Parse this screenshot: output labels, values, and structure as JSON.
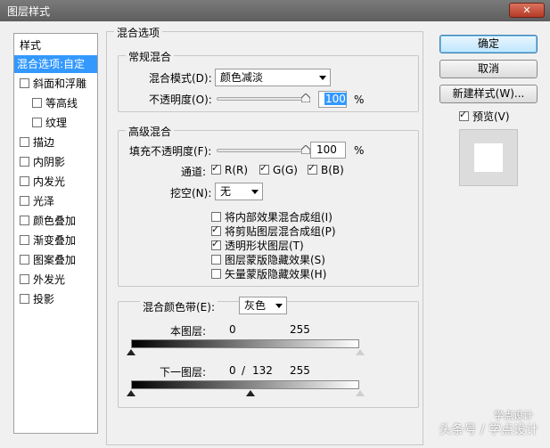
{
  "window": {
    "title": "图层样式",
    "close_label": "✕"
  },
  "stylelist": {
    "header": "样式",
    "items": [
      {
        "label": "混合选项:自定",
        "checkbox": false,
        "checked": false,
        "selected": true,
        "indent": false
      },
      {
        "label": "斜面和浮雕",
        "checkbox": true,
        "checked": false,
        "selected": false,
        "indent": false
      },
      {
        "label": "等高线",
        "checkbox": true,
        "checked": false,
        "selected": false,
        "indent": true
      },
      {
        "label": "纹理",
        "checkbox": true,
        "checked": false,
        "selected": false,
        "indent": true
      },
      {
        "label": "描边",
        "checkbox": true,
        "checked": false,
        "selected": false,
        "indent": false
      },
      {
        "label": "内阴影",
        "checkbox": true,
        "checked": false,
        "selected": false,
        "indent": false
      },
      {
        "label": "内发光",
        "checkbox": true,
        "checked": false,
        "selected": false,
        "indent": false
      },
      {
        "label": "光泽",
        "checkbox": true,
        "checked": false,
        "selected": false,
        "indent": false
      },
      {
        "label": "颜色叠加",
        "checkbox": true,
        "checked": false,
        "selected": false,
        "indent": false
      },
      {
        "label": "渐变叠加",
        "checkbox": true,
        "checked": false,
        "selected": false,
        "indent": false
      },
      {
        "label": "图案叠加",
        "checkbox": true,
        "checked": false,
        "selected": false,
        "indent": false
      },
      {
        "label": "外发光",
        "checkbox": true,
        "checked": false,
        "selected": false,
        "indent": false
      },
      {
        "label": "投影",
        "checkbox": true,
        "checked": false,
        "selected": false,
        "indent": false
      }
    ]
  },
  "blend_options": {
    "title": "混合选项",
    "general": {
      "title": "常规混合",
      "blend_mode_label": "混合模式(D):",
      "blend_mode_value": "颜色减淡",
      "opacity_label": "不透明度(O):",
      "opacity_value": "100",
      "opacity_unit": "%",
      "opacity_level": 1.0
    },
    "advanced": {
      "title": "高级混合",
      "fill_opacity_label": "填充不透明度(F):",
      "fill_opacity_value": "100",
      "fill_opacity_unit": "%",
      "fill_opacity_level": 1.0,
      "channels_label": "通道:",
      "channel_r": "R(R)",
      "channel_g": "G(G)",
      "channel_b": "B(B)",
      "knockout_label": "挖空(N):",
      "knockout_value": "无",
      "options": [
        {
          "label": "将内部效果混合成组(I)",
          "checked": false
        },
        {
          "label": "将剪贴图层混合成组(P)",
          "checked": true
        },
        {
          "label": "透明形状图层(T)",
          "checked": true
        },
        {
          "label": "图层蒙版隐藏效果(S)",
          "checked": false
        },
        {
          "label": "矢量蒙版隐藏效果(H)",
          "checked": false
        }
      ]
    },
    "blend_if": {
      "label": "混合颜色带(E):",
      "value": "灰色",
      "this_layer_label": "本图层:",
      "this_layer_low": "0",
      "this_layer_high": "255",
      "underlying_label": "下一图层:",
      "underlying_low": "0",
      "underlying_sep": "/",
      "underlying_mid": "132",
      "underlying_high": "255"
    }
  },
  "buttons": {
    "ok": "确定",
    "cancel": "取消",
    "new_style": "新建样式(W)...",
    "preview_label": "预览(V)"
  },
  "watermark": {
    "top": "学点设计",
    "bottom": "头条号 / 学点设计"
  }
}
